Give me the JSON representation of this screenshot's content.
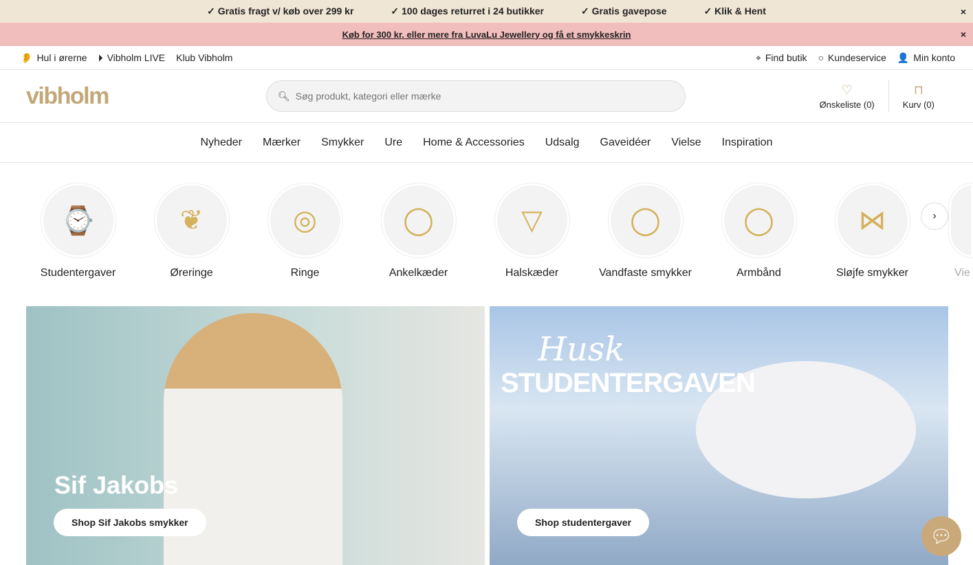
{
  "promo": {
    "items": [
      "✓ Gratis fragt v/ køb over 299 kr",
      "✓ 100 dages returret i 24 butikker",
      "✓ Gratis gavepose",
      "✓ Klik & Hent"
    ],
    "campaign": "Køb for 300 kr. eller mere fra LuvaLu Jewellery og få et smykkeskrin",
    "close": "×"
  },
  "util": {
    "left": [
      "Hul i ørerne",
      "Vibholm LIVE",
      "Klub Vibholm"
    ],
    "right": [
      "Find butik",
      "Kundeservice",
      "Min konto"
    ]
  },
  "header": {
    "logo": "vibholm",
    "search_placeholder": "Søg produkt, kategori eller mærke",
    "wishlist": "Ønskeliste (0)",
    "cart": "Kurv (0)"
  },
  "nav": [
    "Nyheder",
    "Mærker",
    "Smykker",
    "Ure",
    "Home & Accessories",
    "Udsalg",
    "Gaveidéer",
    "Vielse",
    "Inspiration"
  ],
  "categories": [
    "Studentergaver",
    "Øreringe",
    "Ringe",
    "Ankelkæder",
    "Halskæder",
    "Vandfaste smykker",
    "Armbånd",
    "Sløjfe smykker",
    "Vie"
  ],
  "banners": [
    {
      "title": "Sif Jakobs",
      "button": "Shop Sif Jakobs smykker"
    },
    {
      "script": "Husk",
      "headline": "STUDENTERGAVEN",
      "button": "Shop studentergaver"
    }
  ],
  "colors": {
    "gold": "#c2a878",
    "promo_bg": "#f0e6d6",
    "campaign_bg": "#f2bdbd"
  }
}
